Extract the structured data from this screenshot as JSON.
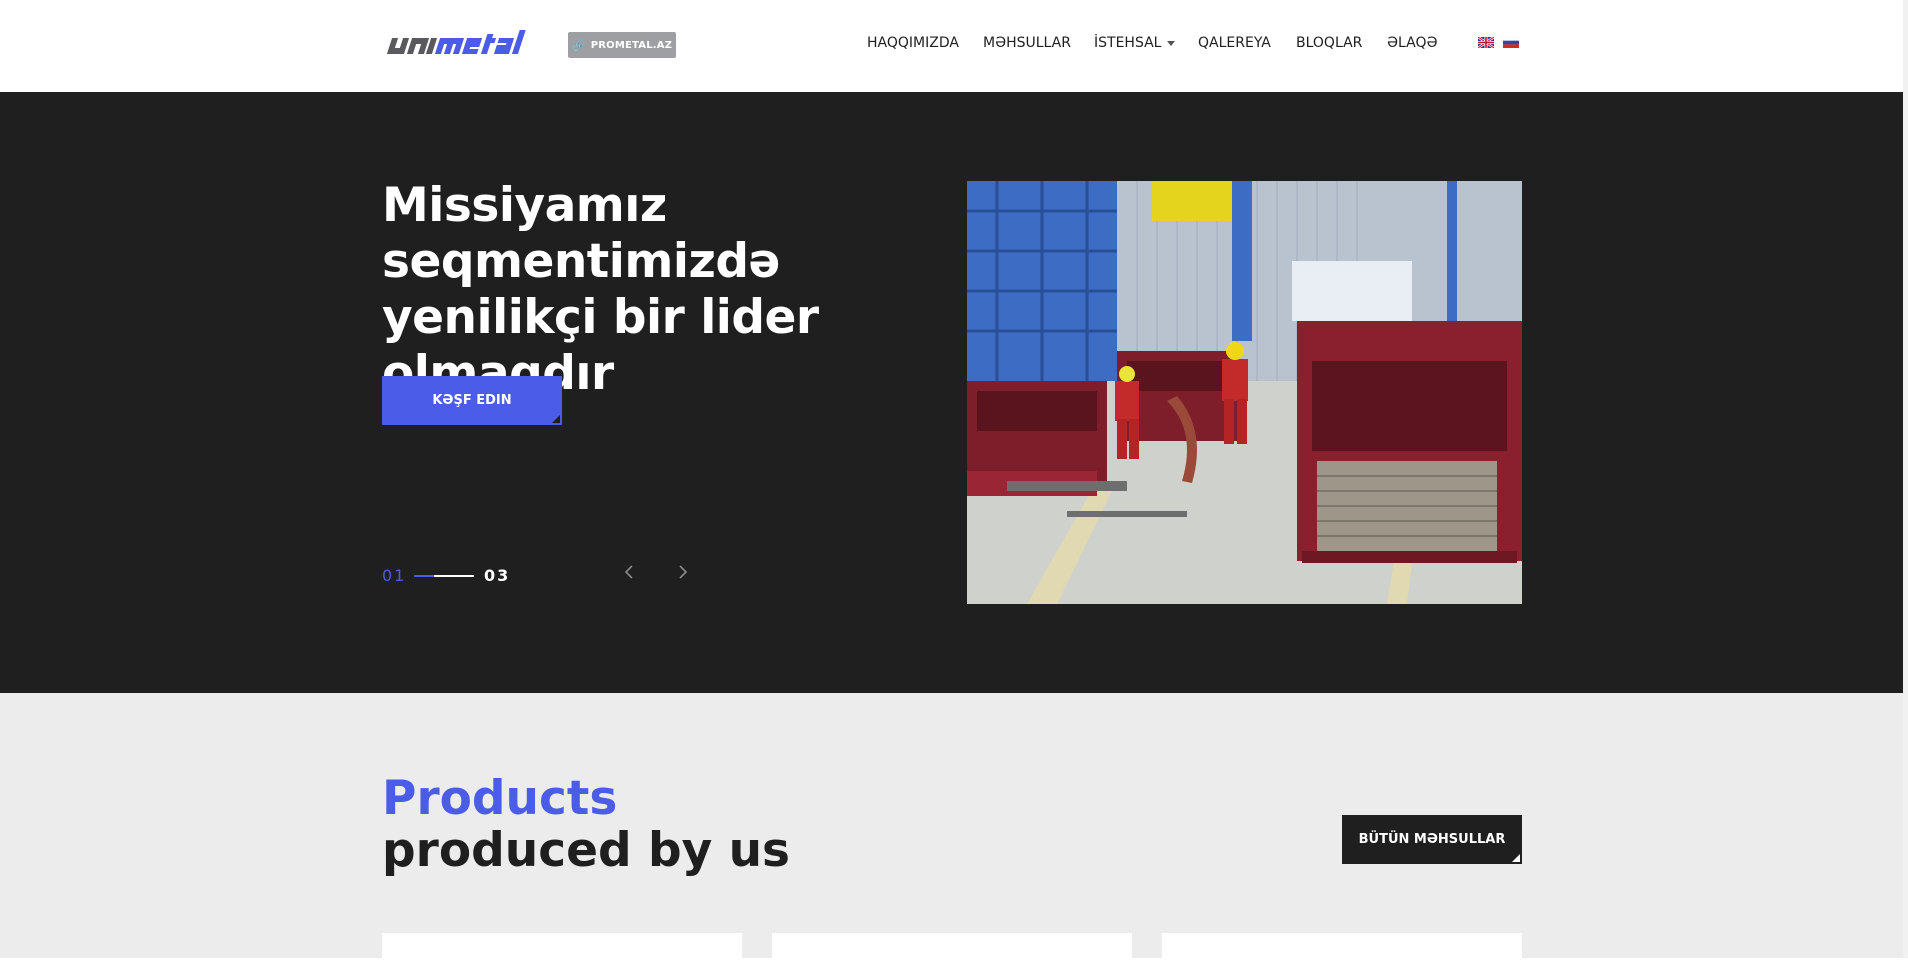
{
  "header": {
    "logo_text": "unimetal",
    "site_link_label": "PROMETAL.AZ",
    "nav": [
      {
        "label": "HAQQIMIZDA"
      },
      {
        "label": "MƏHSULLAR"
      },
      {
        "label": "İSTEHSAL"
      },
      {
        "label": "QALEREYA"
      },
      {
        "label": "BLOQLAR"
      },
      {
        "label": "ƏLAQƏ"
      }
    ],
    "languages": [
      "en-flag-icon",
      "ru-flag-icon"
    ]
  },
  "hero": {
    "title": "Missiyamız seqmentimizdə yenilikçi bir lider olmaqdır",
    "cta_label": "KƏŞF EDIN",
    "slide_current": "01",
    "slide_total": "03",
    "slide_progress": 0.33
  },
  "products": {
    "title_accent": "Products",
    "title_rest": "produced by us",
    "all_button_label": "BÜTÜN MƏHSULLAR"
  },
  "colors": {
    "accent": "#4b5ce8",
    "dark": "#1f1f20",
    "link_badge": "#9e9fa3"
  }
}
